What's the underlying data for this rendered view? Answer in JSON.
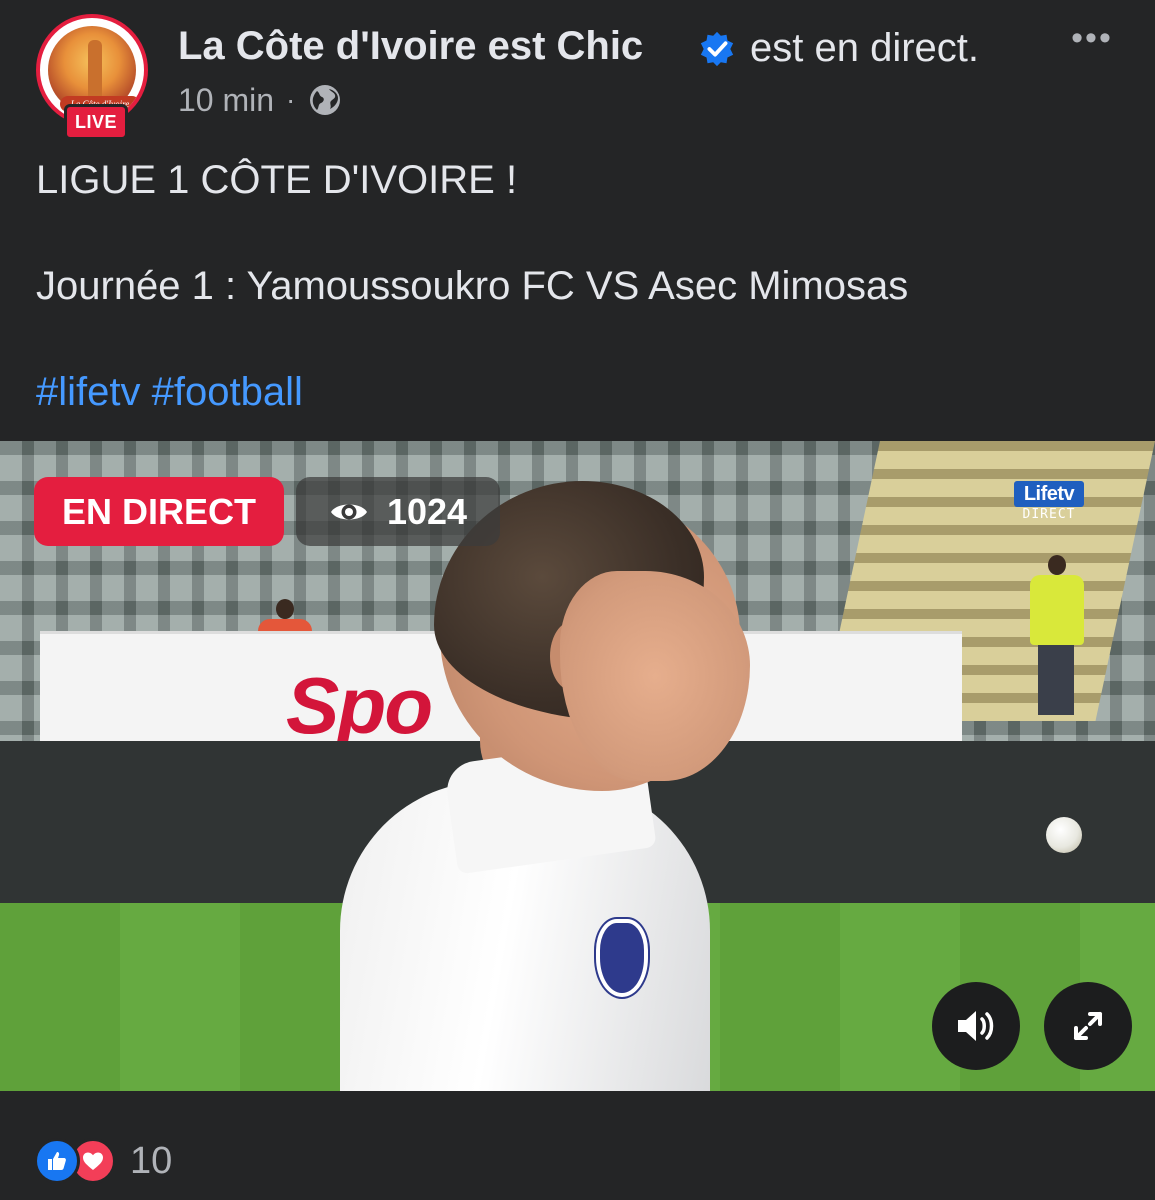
{
  "post": {
    "page_name": "La Côte d'Ivoire est Chic",
    "status": "est en direct.",
    "time": "10 min",
    "separator": "·",
    "avatar_text": "La Côte d'Ivoire",
    "live_badge": "LIVE",
    "more_label": "•••",
    "verified": true,
    "privacy_icon": "globe-icon"
  },
  "text": {
    "title": "LIGUE 1 CÔTE D'IVOIRE !",
    "match": "Journée 1 : Yamoussoukro FC VS Asec Mimosas",
    "hashtags": [
      "#lifetv",
      "#football"
    ]
  },
  "video": {
    "live_label": "EN DIRECT",
    "viewers": "1024",
    "channel_name": "Lifetv",
    "channel_sub": "DIRECT",
    "ad_text": "Spo",
    "controls": [
      "sound-icon",
      "fullscreen-icon"
    ]
  },
  "reactions": {
    "count": "10",
    "types": [
      "like-icon",
      "love-icon"
    ]
  },
  "colors": {
    "background": "#242526",
    "text": "#e4e6eb",
    "secondary": "#b0b3b8",
    "hashtag": "#4599ff",
    "live_red": "#e41e3f",
    "like_blue": "#1877f2",
    "love_red": "#f33e58"
  }
}
